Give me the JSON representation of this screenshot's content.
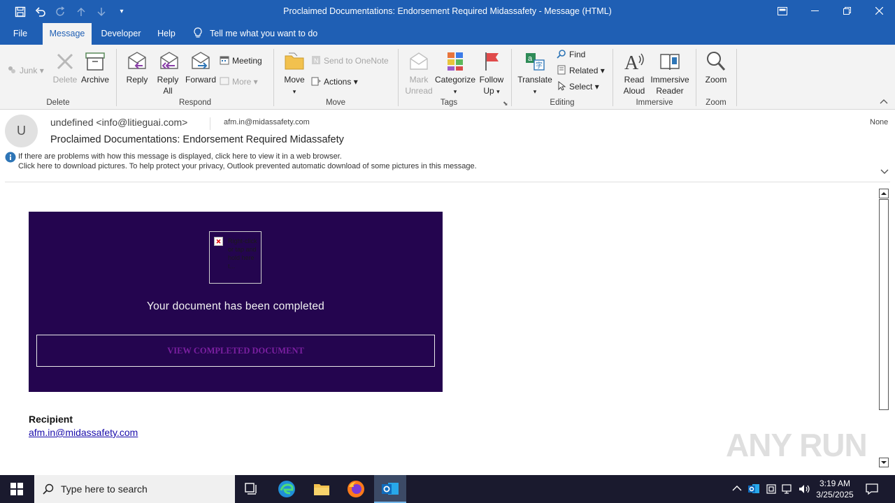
{
  "window": {
    "title": "Proclaimed Documentations: Endorsement Required Midassafety  -  Message (HTML)"
  },
  "menu": {
    "tabs": [
      "File",
      "Message",
      "Developer",
      "Help"
    ],
    "tell_me": "Tell me what you want to do"
  },
  "ribbon": {
    "delete_group": {
      "junk": "Junk",
      "delete": "Delete",
      "archive": "Archive",
      "label": "Delete"
    },
    "respond_group": {
      "reply": "Reply",
      "reply_all_1": "Reply",
      "reply_all_2": "All",
      "forward": "Forward",
      "meeting": "Meeting",
      "more": "More",
      "label": "Respond"
    },
    "move_group": {
      "move": "Move",
      "send_onenote": "Send to OneNote",
      "actions": "Actions",
      "label": "Move"
    },
    "tags_group": {
      "mark_unread_1": "Mark",
      "mark_unread_2": "Unread",
      "categorize": "Categorize",
      "follow_up_1": "Follow",
      "follow_up_2": "Up",
      "label": "Tags"
    },
    "editing_group": {
      "translate": "Translate",
      "find": "Find",
      "related": "Related",
      "select": "Select",
      "label": "Editing"
    },
    "immersive_group": {
      "read_aloud_1": "Read",
      "read_aloud_2": "Aloud",
      "immersive_reader_1": "Immersive",
      "immersive_reader_2": "Reader",
      "label": "Immersive"
    },
    "zoom_group": {
      "zoom": "Zoom",
      "label": "Zoom"
    }
  },
  "message": {
    "avatar_initial": "U",
    "from": "undefined <info@litieguai.com>",
    "to": "afm.in@midassafety.com",
    "retention": "None",
    "subject": "Proclaimed Documentations: Endorsement Required Midassafety",
    "info_line1": "If there are problems with how this message is displayed, click here to view it in a web browser.",
    "info_line2": "Click here to download pictures. To help protect your privacy, Outlook prevented automatic download of some pictures in this message."
  },
  "body": {
    "image_placeholder": "Right-click or tap and hold here t...",
    "completed_text": "Your document has been completed",
    "cta": "VIEW COMPLETED DOCUMENT",
    "recipient_label": "Recipient",
    "recipient_email": "afm.in@midassafety.com",
    "watermark": "ANY RUN"
  },
  "taskbar": {
    "search_placeholder": "Type here to search",
    "time": "3:19 AM",
    "date": "3/25/2025"
  },
  "colors": {
    "accent": "#1f5fb4",
    "promo_bg": "#24054f",
    "cta_text": "#7a1fa0"
  }
}
